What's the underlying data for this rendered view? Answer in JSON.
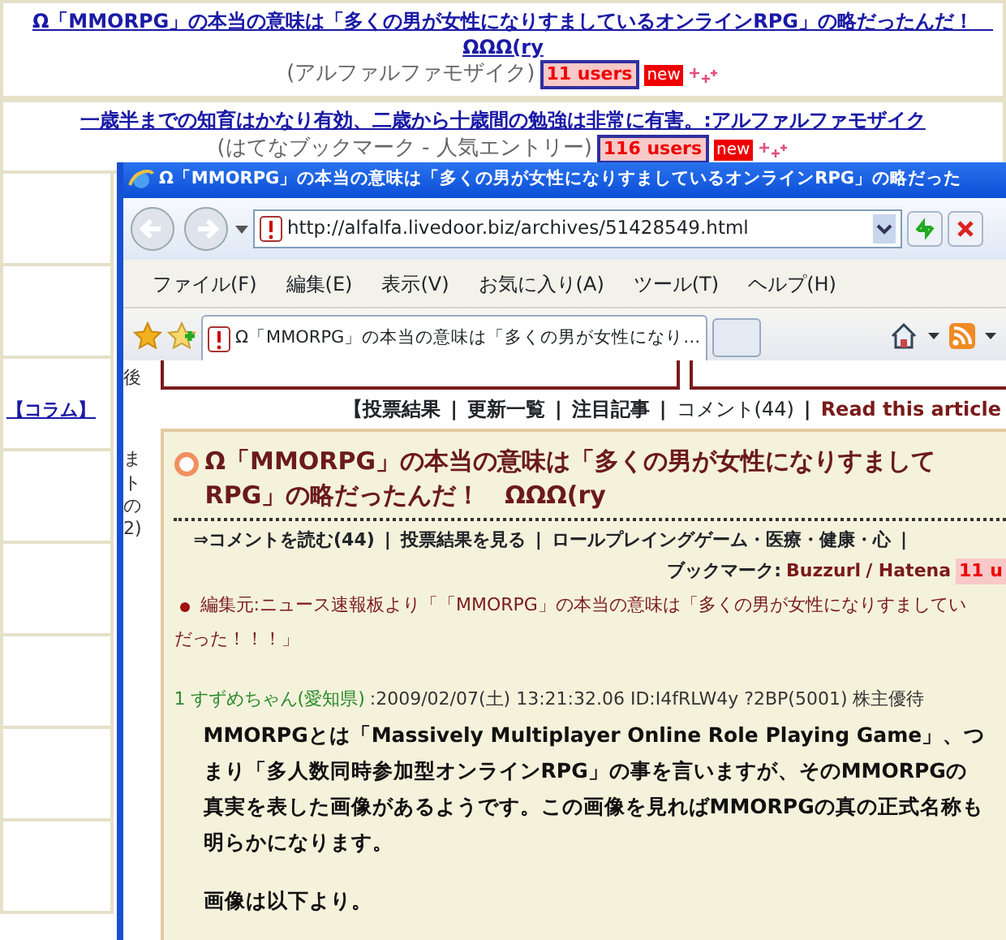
{
  "background_page": {
    "entries": [
      {
        "title": "Ω「MMORPG」の本当の意味は「多くの男が女性になりすましているオンラインRPG」の略だったんだ！　ΩΩΩ(ry",
        "source": "(アルファルファモザイク)",
        "users": "11 users",
        "badge": "new"
      },
      {
        "title": "一歳半までの知育はかなり有効、二歳から十歳間の勉強は非常に有害。:アルファルファモザイク",
        "source": "(はてなブックマーク - 人気エントリー)",
        "users": "116 users",
        "badge": "new"
      }
    ],
    "sidebar_link": "【コラム】"
  },
  "window": {
    "title": "Ω「MMORPG」の本当の意味は「多くの男が女性になりすましているオンラインRPG」の略だった",
    "address": "http://alfalfa.livedoor.biz/archives/51428549.html",
    "menu": [
      "ファイル(F)",
      "編集(E)",
      "表示(V)",
      "お気に入り(A)",
      "ツール(T)",
      "ヘルプ(H)"
    ],
    "tabs": [
      {
        "label": "Ω「MMORPG」の本当の意味は「多くの男が女性になり…",
        "selected": true
      }
    ],
    "content": {
      "separator": "|",
      "side_fragments": [
        "後",
        "ま",
        "ト",
        "の",
        "2)"
      ],
      "nav": [
        "【投票結果",
        "更新一覧",
        "注目記事",
        "コメント(44)",
        "Read this article"
      ],
      "title_lines": [
        "Ω「MMORPG」の本当の意味は「多くの男が女性になりすまして",
        "RPG」の略だったんだ！　ΩΩΩ(ry"
      ],
      "actions": [
        "⇒コメントを読む(44)",
        "投票結果を見る",
        "ロールプレイングゲーム・医療・健康・心"
      ],
      "bookmarks": {
        "label": "ブックマーク:",
        "links": [
          "Buzzurl",
          "/ Hatena"
        ],
        "users": "11 u"
      },
      "quote_lines": [
        "編集元:ニュース速報板より「「MMORPG」の本当の意味は「多くの男が女性になりすましてい",
        "だった！！！」"
      ],
      "post": {
        "number": "1",
        "author": "すずめちゃん(愛知県)",
        "meta": ":2009/02/07(土) 13:21:32.06 ID:I4fRLW4y ?2BP(5001) 株主優待",
        "paragraphs": [
          "MMORPGとは「Massively Multiplayer Online Role Playing Game」、つまり「多人数同時参加型オンラインRPG」の事を言いますが、そのMMORPGの真実を表した画像があるようです。この画像を見ればMMORPGの真の正式名称も明らかになります。",
          "画像は以下より。"
        ]
      }
    }
  }
}
